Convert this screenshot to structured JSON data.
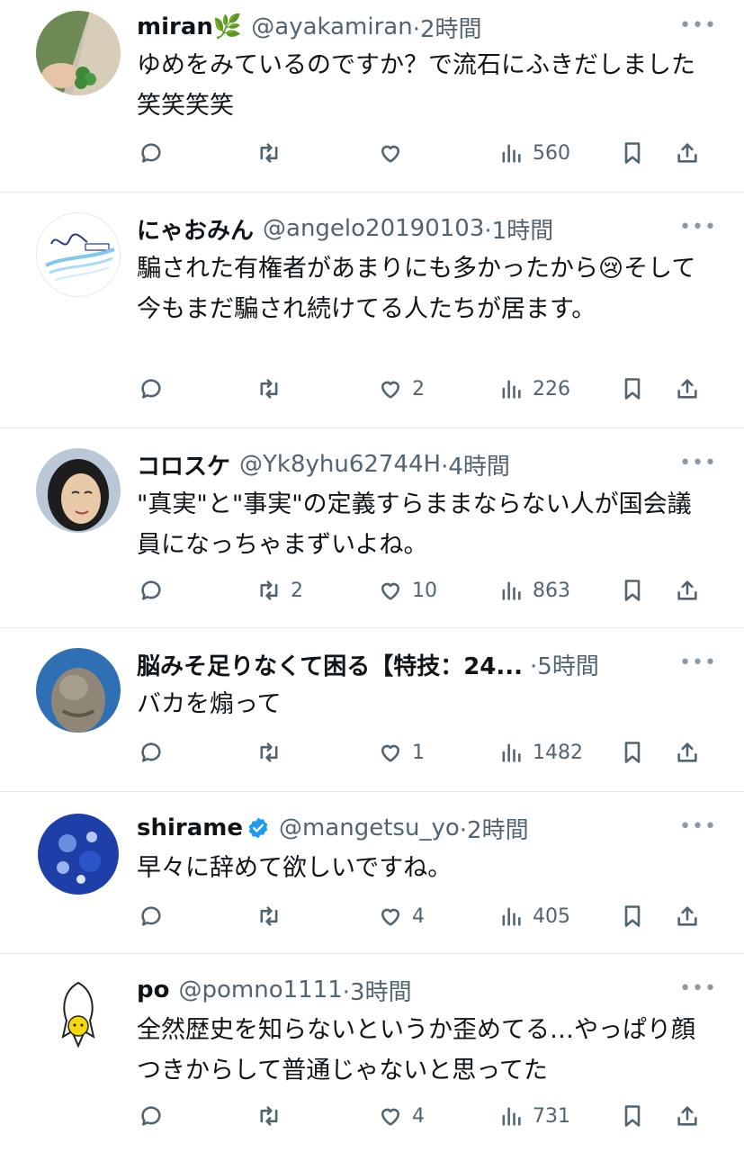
{
  "tweets": [
    {
      "name": "miran🌿",
      "handle": "@ayakamiran",
      "time": "·2時間",
      "text": "ゆめをみているのですか？で流石にふきだしました笑笑笑笑",
      "reply": "",
      "retweets": "",
      "likes": "",
      "views": "560",
      "verified": false,
      "emoji": ""
    },
    {
      "name": "にゃおみん",
      "handle": "@angelo20190103",
      "time": "·1時間",
      "text": "騙された有権者があまりにも多かったから😢そして今もまだ騙され続けてる人たちが居ます。",
      "reply": "",
      "retweets": "",
      "likes": "2",
      "views": "226",
      "verified": false,
      "emoji": ""
    },
    {
      "name": "コロスケ",
      "handle": "@Yk8yhu62744H",
      "time": "·4時間",
      "text": "\"真実\"と\"事実\"の定義すらままならない人が国会議員になっちゃまずいよね。",
      "reply": "",
      "retweets": "2",
      "likes": "10",
      "views": "863",
      "verified": false,
      "emoji": ""
    },
    {
      "name": "脳みそ足りなくて困る【特技：24...",
      "handle": "",
      "time": "·5時間",
      "text": "バカを煽って",
      "reply": "",
      "retweets": "",
      "likes": "1",
      "views": "1482",
      "verified": false,
      "emoji": ""
    },
    {
      "name": "shirame",
      "handle": "@mangetsu_yo",
      "time": "·2時間",
      "text": "早々に辞めて欲しいですね。",
      "reply": "",
      "retweets": "",
      "likes": "4",
      "views": "405",
      "verified": true,
      "emoji": ""
    },
    {
      "name": "po",
      "handle": "@pomno1111",
      "time": "·3時間",
      "text": "全然歴史を知らないというか歪めてる…やっぱり顔つきからして普通じゃないと思ってた",
      "reply": "",
      "retweets": "",
      "likes": "4",
      "views": "731",
      "verified": false,
      "emoji": ""
    }
  ],
  "colors": {
    "text": "#0f1419",
    "secondary": "#536471",
    "divider": "#e6e9ec",
    "verified": "#1d9bf0"
  },
  "icons": {
    "reply": "reply-icon",
    "retweet": "retweet-icon",
    "like": "heart-icon",
    "views": "views-icon",
    "bookmark": "bookmark-icon",
    "share": "share-icon",
    "more": "more-icon"
  }
}
